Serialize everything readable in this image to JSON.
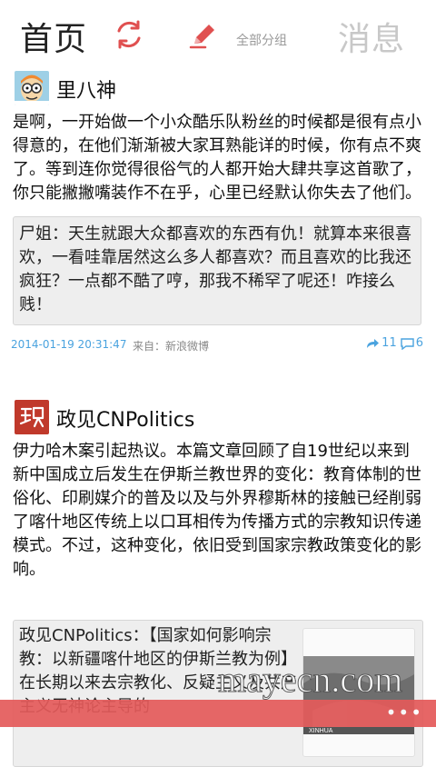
{
  "header": {
    "title": "首页",
    "group_label": "全部分组",
    "messages_label": "消息",
    "icons": {
      "refresh": "refresh-icon",
      "compose": "compose-icon"
    },
    "accent_color": "#e05050"
  },
  "posts": [
    {
      "username": "里八神",
      "avatar": "cartoon-avatar",
      "text": "是啊，一开始做一个小众酷乐队粉丝的时候都是很有点小得意的，在他们渐渐被大家耳熟能详的时候，你有点不爽了。等到连你觉得很俗气的人都开始大肆共享这首歌了，你只能撇撇嘴装作不在乎，心里已经默认你失去了他们。",
      "retweet": "尸姐：天生就跟大众都喜欢的东西有仇！就算本来很喜欢，一看哇靠居然这么多人都喜欢？而且喜欢的比我还疯狂？一点都不酷了哼，那我不稀罕了呢还！咋接么贱！",
      "time": "2014-01-19 20:31:47",
      "source": "来自：新浪微博",
      "reposts": "11",
      "comments": "6"
    },
    {
      "username": "政见CNPolitics",
      "avatar": "cnpolitics-logo",
      "text": "伊力哈木案引起热议。本篇文章回顾了自19世纪以来到新中国成立后发生在伊斯兰教世界的变化：教育体制的世俗化、印刷媒介的普及以及与外界穆斯林的接触已经削弱了喀什地区传统上以口耳相传为传播方式的宗教知识传递模式。不过，这种变化，依旧受到国家宗教政策变化的影响。",
      "retweet": "政见CNPolitics：【国家如何影响宗教：以新疆喀什地区的伊斯兰教为例】在长期以来去宗教化、反疑主义及共产主义无神论主导的",
      "thumb_label": "XINHUA"
    }
  ],
  "footer": {
    "more_label": "•••",
    "watermark": "mayecn.com"
  }
}
